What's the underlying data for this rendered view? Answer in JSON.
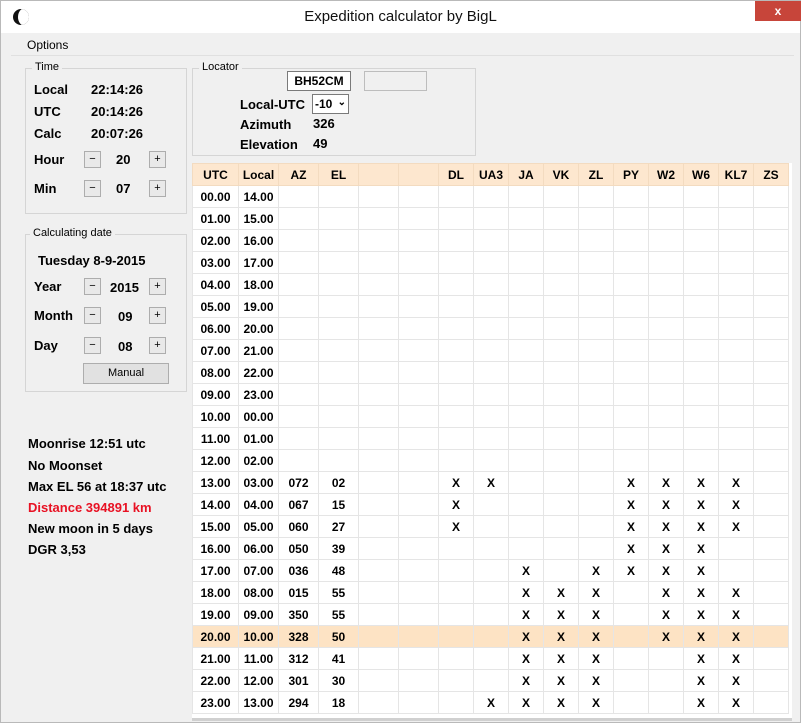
{
  "window": {
    "title": "Expedition calculator by BigL",
    "close_label": "x"
  },
  "menu": {
    "options": "Options"
  },
  "time": {
    "legend": "Time",
    "local_label": "Local",
    "local_value": "22:14:26",
    "utc_label": "UTC",
    "utc_value": "20:14:26",
    "calc_label": "Calc",
    "calc_value": "20:07:26",
    "hour_label": "Hour",
    "hour_value": "20",
    "min_label": "Min",
    "min_value": "07",
    "minus": "−",
    "plus": "+"
  },
  "date": {
    "legend": "Calculating date",
    "date_text": "Tuesday 8-9-2015",
    "year_label": "Year",
    "year_value": "2015",
    "month_label": "Month",
    "month_value": "09",
    "day_label": "Day",
    "day_value": "08",
    "manual_button": "Manual"
  },
  "locator": {
    "legend": "Locator",
    "locator_value": "BH52CM",
    "secondary_value": "",
    "local_utc_label": "Local-UTC",
    "local_utc_value": "-10",
    "azimuth_label": "Azimuth",
    "azimuth_value": "326",
    "elevation_label": "Elevation",
    "elevation_value": "49"
  },
  "moon_info": {
    "moonrise": "Moonrise 12:51 utc",
    "moonset": "No Moonset",
    "max_el": "Max EL 56 at 18:37 utc",
    "distance": "Distance 394891 km",
    "new_moon": "New moon in 5 days",
    "dgr": "DGR 3,53"
  },
  "colors": {
    "highlight_row": "#fde3c4",
    "header": "#fde7cf",
    "distance": "#e81123"
  },
  "grid": {
    "headers": [
      "UTC",
      "Local",
      "AZ",
      "EL",
      "",
      "",
      "DL",
      "UA3",
      "JA",
      "VK",
      "ZL",
      "PY",
      "W2",
      "W6",
      "KL7",
      "ZS"
    ],
    "highlight_index": 20,
    "rows": [
      [
        "00.00",
        "14.00",
        "",
        "",
        "",
        "",
        "",
        "",
        "",
        "",
        "",
        "",
        "",
        "",
        "",
        ""
      ],
      [
        "01.00",
        "15.00",
        "",
        "",
        "",
        "",
        "",
        "",
        "",
        "",
        "",
        "",
        "",
        "",
        "",
        ""
      ],
      [
        "02.00",
        "16.00",
        "",
        "",
        "",
        "",
        "",
        "",
        "",
        "",
        "",
        "",
        "",
        "",
        "",
        ""
      ],
      [
        "03.00",
        "17.00",
        "",
        "",
        "",
        "",
        "",
        "",
        "",
        "",
        "",
        "",
        "",
        "",
        "",
        ""
      ],
      [
        "04.00",
        "18.00",
        "",
        "",
        "",
        "",
        "",
        "",
        "",
        "",
        "",
        "",
        "",
        "",
        "",
        ""
      ],
      [
        "05.00",
        "19.00",
        "",
        "",
        "",
        "",
        "",
        "",
        "",
        "",
        "",
        "",
        "",
        "",
        "",
        ""
      ],
      [
        "06.00",
        "20.00",
        "",
        "",
        "",
        "",
        "",
        "",
        "",
        "",
        "",
        "",
        "",
        "",
        "",
        ""
      ],
      [
        "07.00",
        "21.00",
        "",
        "",
        "",
        "",
        "",
        "",
        "",
        "",
        "",
        "",
        "",
        "",
        "",
        ""
      ],
      [
        "08.00",
        "22.00",
        "",
        "",
        "",
        "",
        "",
        "",
        "",
        "",
        "",
        "",
        "",
        "",
        "",
        ""
      ],
      [
        "09.00",
        "23.00",
        "",
        "",
        "",
        "",
        "",
        "",
        "",
        "",
        "",
        "",
        "",
        "",
        "",
        ""
      ],
      [
        "10.00",
        "00.00",
        "",
        "",
        "",
        "",
        "",
        "",
        "",
        "",
        "",
        "",
        "",
        "",
        "",
        ""
      ],
      [
        "11.00",
        "01.00",
        "",
        "",
        "",
        "",
        "",
        "",
        "",
        "",
        "",
        "",
        "",
        "",
        "",
        ""
      ],
      [
        "12.00",
        "02.00",
        "",
        "",
        "",
        "",
        "",
        "",
        "",
        "",
        "",
        "",
        "",
        "",
        "",
        ""
      ],
      [
        "13.00",
        "03.00",
        "072",
        "02",
        "",
        "",
        "X",
        "X",
        "",
        "",
        "",
        "X",
        "X",
        "X",
        "X",
        ""
      ],
      [
        "14.00",
        "04.00",
        "067",
        "15",
        "",
        "",
        "X",
        "",
        "",
        "",
        "",
        "X",
        "X",
        "X",
        "X",
        ""
      ],
      [
        "15.00",
        "05.00",
        "060",
        "27",
        "",
        "",
        "X",
        "",
        "",
        "",
        "",
        "X",
        "X",
        "X",
        "X",
        ""
      ],
      [
        "16.00",
        "06.00",
        "050",
        "39",
        "",
        "",
        "",
        "",
        "",
        "",
        "",
        "X",
        "X",
        "X",
        "",
        ""
      ],
      [
        "17.00",
        "07.00",
        "036",
        "48",
        "",
        "",
        "",
        "",
        "X",
        "",
        "X",
        "X",
        "X",
        "X",
        "",
        ""
      ],
      [
        "18.00",
        "08.00",
        "015",
        "55",
        "",
        "",
        "",
        "",
        "X",
        "X",
        "X",
        "",
        "X",
        "X",
        "X",
        ""
      ],
      [
        "19.00",
        "09.00",
        "350",
        "55",
        "",
        "",
        "",
        "",
        "X",
        "X",
        "X",
        "",
        "X",
        "X",
        "X",
        ""
      ],
      [
        "20.00",
        "10.00",
        "328",
        "50",
        "",
        "",
        "",
        "",
        "X",
        "X",
        "X",
        "",
        "X",
        "X",
        "X",
        ""
      ],
      [
        "21.00",
        "11.00",
        "312",
        "41",
        "",
        "",
        "",
        "",
        "X",
        "X",
        "X",
        "",
        "",
        "X",
        "X",
        ""
      ],
      [
        "22.00",
        "12.00",
        "301",
        "30",
        "",
        "",
        "",
        "",
        "X",
        "X",
        "X",
        "",
        "",
        "X",
        "X",
        ""
      ],
      [
        "23.00",
        "13.00",
        "294",
        "18",
        "",
        "",
        "",
        "X",
        "X",
        "X",
        "X",
        "",
        "",
        "X",
        "X",
        ""
      ]
    ]
  }
}
